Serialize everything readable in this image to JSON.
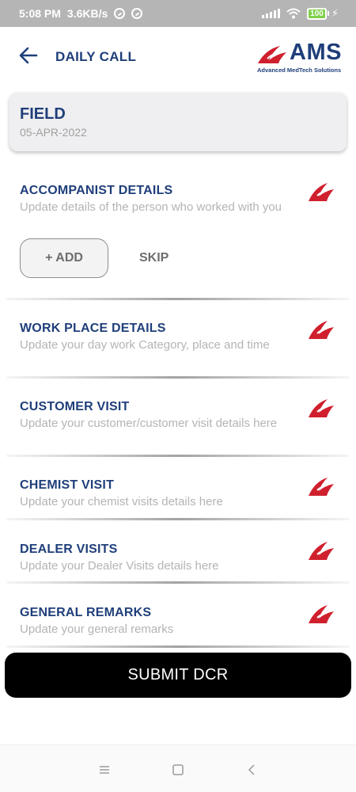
{
  "status_bar": {
    "time": "5:08 PM",
    "speed": "3.6KB/s",
    "battery": "100"
  },
  "header": {
    "title": "DAILY CALL",
    "logo_text": "AMS",
    "logo_tagline": "Advanced MedTech Solutions"
  },
  "field_card": {
    "title": "FIELD",
    "date": "05-APR-2022"
  },
  "sections": [
    {
      "title": "ACCOMPANIST DETAILS",
      "desc": "Update details of the person who worked with you"
    },
    {
      "title": "WORK PLACE DETAILS",
      "desc": "Update your day work Category, place and time"
    },
    {
      "title": "CUSTOMER VISIT",
      "desc": "Update your customer/customer visit details here"
    },
    {
      "title": "CHEMIST VISIT",
      "desc": "Update your chemist visits details here"
    },
    {
      "title": "DEALER VISITS",
      "desc": "Update your Dealer Visits details here"
    },
    {
      "title": "GENERAL REMARKS",
      "desc": "Update your general remarks"
    }
  ],
  "accompanist": {
    "add_label": "+ ADD",
    "skip_label": "SKIP"
  },
  "submit_label": "SUBMIT DCR",
  "colors": {
    "brand_blue": "#1f3f7a",
    "logo_red": "#d0202e",
    "submit_bg": "#000000"
  },
  "icons": {
    "back": "arrow-left-icon",
    "section": "ams-logo-mark-icon",
    "nav_menu": "menu-icon",
    "nav_home": "square-icon",
    "nav_back": "chevron-left-icon"
  }
}
